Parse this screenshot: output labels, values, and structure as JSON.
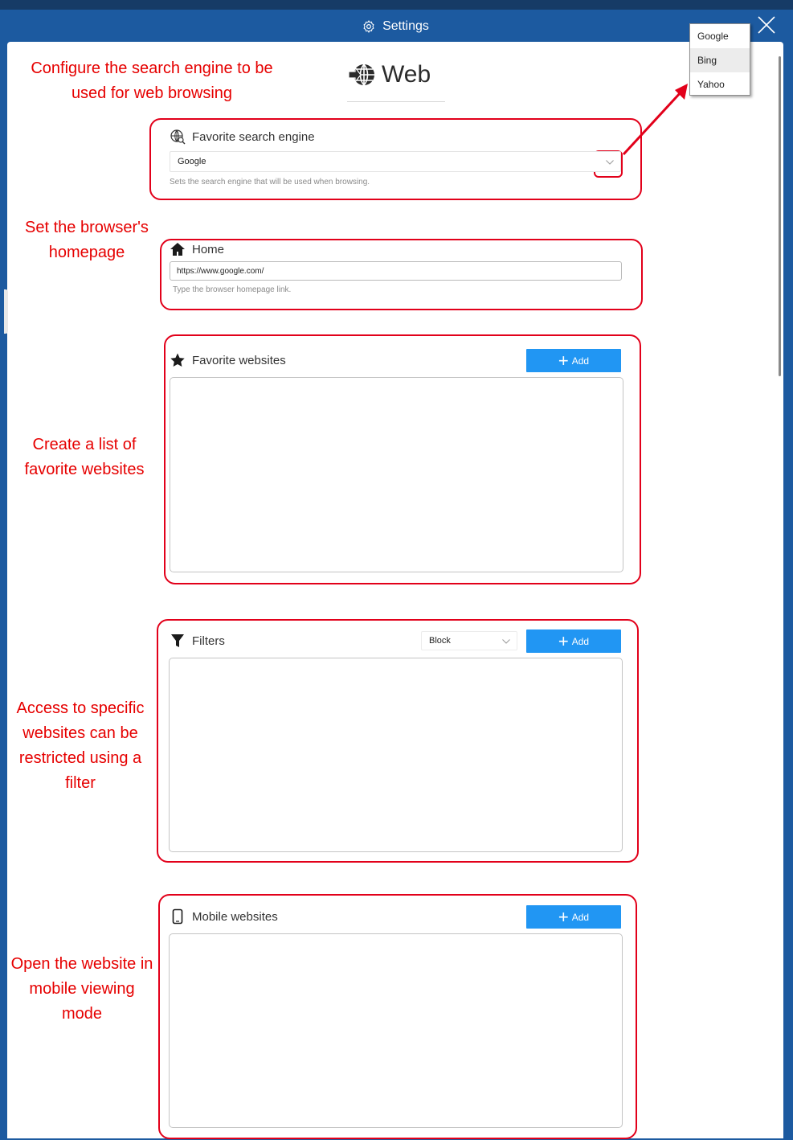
{
  "window": {
    "title": "Settings"
  },
  "page": {
    "heading": "Web"
  },
  "annotations": {
    "search_engine": "Configure the search engine to be used for web browsing",
    "homepage": "Set the browser's homepage",
    "favorites": "Create a list of favorite websites",
    "filters": "Access to specific websites can be restricted using a filter",
    "mobile": "Open the website in mobile viewing mode"
  },
  "search_engine": {
    "label": "Favorite search engine",
    "selected": "Google",
    "hint": "Sets the search engine that will be used when browsing.",
    "options": [
      "Google",
      "Bing",
      "Yahoo"
    ]
  },
  "home": {
    "label": "Home",
    "value": "https://www.google.com/",
    "hint": "Type the browser homepage link."
  },
  "favorites": {
    "label": "Favorite websites",
    "add_label": "Add"
  },
  "filters": {
    "label": "Filters",
    "mode": "Block",
    "add_label": "Add"
  },
  "mobile": {
    "label": "Mobile websites",
    "add_label": "Add"
  },
  "colors": {
    "title_bar": "#1c5aa0",
    "accent_button": "#2196f3",
    "annotation": "#e60000"
  },
  "icons": {
    "title": "gear-icon",
    "heading": "globe-download-icon",
    "search_engine": "globe-search-icon",
    "home": "home-icon",
    "favorites": "star-icon",
    "filters": "funnel-icon",
    "mobile": "phone-icon",
    "close": "close-icon"
  }
}
